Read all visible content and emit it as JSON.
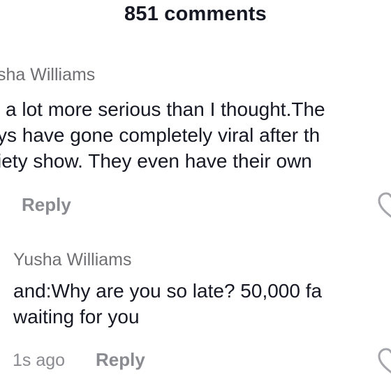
{
  "header": {
    "title": "851 comments"
  },
  "comments": [
    {
      "username": "sha Williams",
      "lines": [
        "a lot more serious than I thought.The",
        "ys have gone completely viral after th",
        "iety show. They even have their own"
      ],
      "reply_label": "Reply",
      "like_icon": "heart-outline-icon"
    },
    {
      "username": "Yusha Williams",
      "lines": [
        "and:Why are you so late? 50,000 fa",
        "waiting for you"
      ],
      "time": "1s ago",
      "reply_label": "Reply",
      "like_icon": "heart-outline-icon"
    }
  ],
  "colors": {
    "primary_text": "#161823",
    "secondary_text": "#8a8b91",
    "username": "#6f6f73",
    "icon_stroke": "#a5a6ab"
  }
}
